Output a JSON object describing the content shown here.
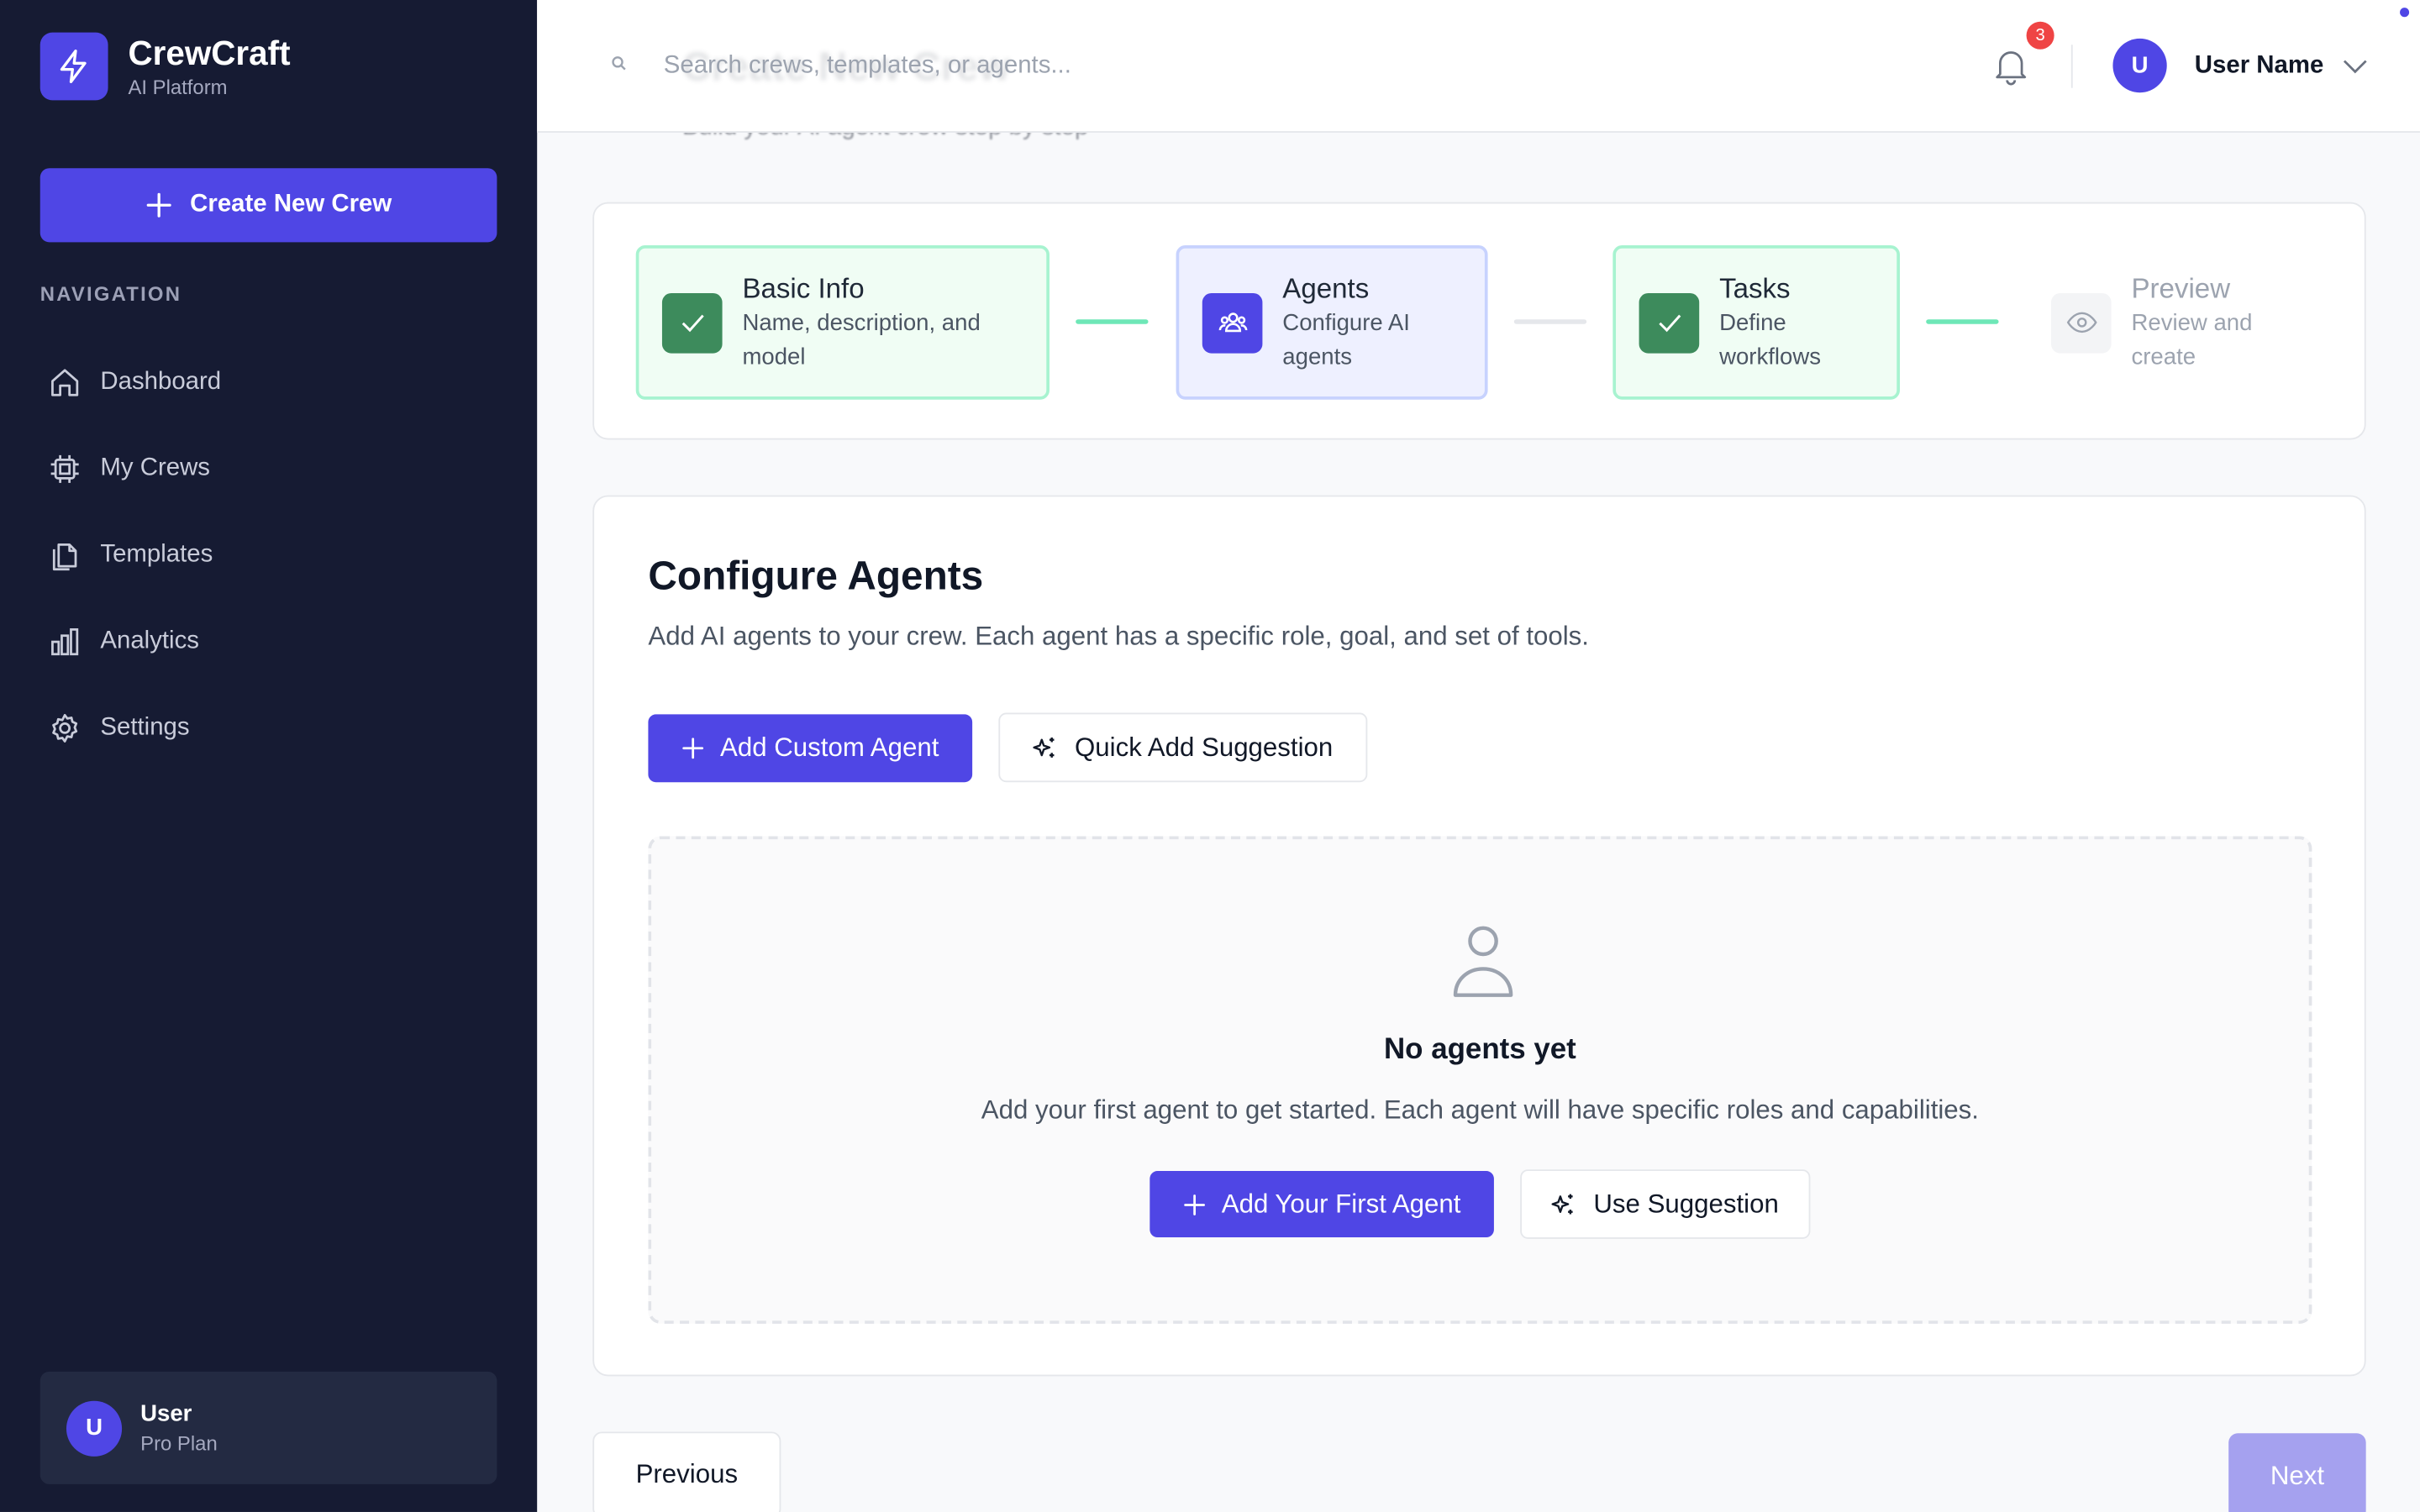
{
  "app": {
    "name": "CrewCraft",
    "subtitle": "AI Platform"
  },
  "sidebar": {
    "create_label": "Create New Crew",
    "nav_title": "NAVIGATION",
    "items": [
      {
        "label": "Dashboard",
        "icon": "home-icon"
      },
      {
        "label": "My Crews",
        "icon": "cpu-icon"
      },
      {
        "label": "Templates",
        "icon": "files-icon"
      },
      {
        "label": "Analytics",
        "icon": "bar-chart-icon"
      },
      {
        "label": "Settings",
        "icon": "gear-icon"
      }
    ],
    "user": {
      "initial": "U",
      "name": "User",
      "plan": "Pro Plan"
    }
  },
  "header": {
    "page_title": "Create New Crew",
    "page_subtitle": "Build your AI agent crew step by step",
    "search_placeholder": "Search crews, templates, or agents...",
    "notification_count": "3",
    "user_initial": "U",
    "user_name": "User Name"
  },
  "steps": [
    {
      "title": "Basic Info",
      "desc": "Name, description, and model",
      "status": "done"
    },
    {
      "title": "Agents",
      "desc": "Configure AI agents",
      "status": "active"
    },
    {
      "title": "Tasks",
      "desc": "Define workflows",
      "status": "done"
    },
    {
      "title": "Preview",
      "desc": "Review and create",
      "status": "pending"
    }
  ],
  "main": {
    "title": "Configure Agents",
    "description": "Add AI agents to your crew. Each agent has a specific role, goal, and set of tools.",
    "add_custom_label": "Add Custom Agent",
    "quick_add_label": "Quick Add Suggestion",
    "empty": {
      "title": "No agents yet",
      "description": "Add your first agent to get started. Each agent will have specific roles and capabilities.",
      "add_first_label": "Add Your First Agent",
      "use_suggestion_label": "Use Suggestion"
    }
  },
  "footer": {
    "previous_label": "Previous",
    "next_label": "Next"
  },
  "colors": {
    "accent": "#4f46e5",
    "sidebar": "#161b33",
    "success": "#3d8b5c",
    "badge": "#ef4444"
  }
}
